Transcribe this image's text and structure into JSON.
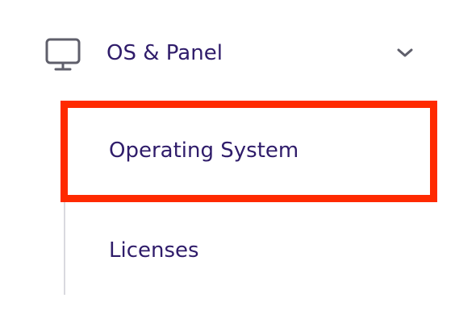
{
  "menu": {
    "header": {
      "label": "OS & Panel",
      "icon": "monitor-icon",
      "toggle_icon": "chevron-down-icon",
      "expanded": true
    },
    "items": [
      {
        "label": "Operating System",
        "highlighted": true
      },
      {
        "label": "Licenses",
        "highlighted": false
      }
    ]
  },
  "colors": {
    "text": "#2f1c6a",
    "icon": "#5f5f6b",
    "highlight": "#ff2a00",
    "submenu_line": "#d9d9df"
  }
}
